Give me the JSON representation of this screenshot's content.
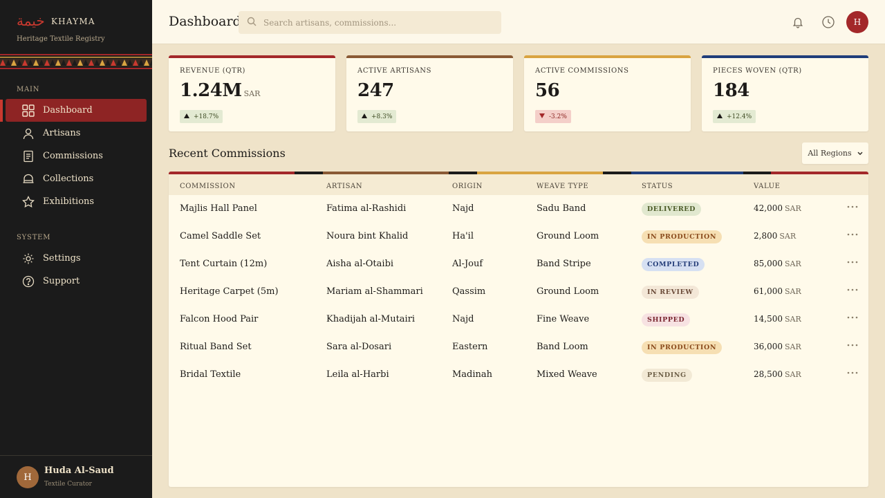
{
  "brand": {
    "logo_glyph": "خيمة",
    "name": "KHAYMA",
    "subtitle": "Heritage Textile Registry",
    "logo_color": "#c9392f"
  },
  "sidebar": {
    "main_label": "MAIN",
    "system_label": "SYSTEM",
    "main_items": [
      {
        "label": "Dashboard",
        "icon": "grid-icon",
        "active": true
      },
      {
        "label": "Artisans",
        "icon": "user-icon"
      },
      {
        "label": "Commissions",
        "icon": "document-icon"
      },
      {
        "label": "Collections",
        "icon": "tent-icon"
      },
      {
        "label": "Exhibitions",
        "icon": "star-icon"
      }
    ],
    "system_items": [
      {
        "label": "Settings",
        "icon": "gear-icon"
      },
      {
        "label": "Support",
        "icon": "help-icon"
      }
    ],
    "user": {
      "initial": "H",
      "name": "Huda Al-Saud",
      "role": "Textile Curator"
    }
  },
  "header": {
    "title": "Dashboard",
    "search_placeholder": "Search artisans, commissions...",
    "avatar_initial": "H"
  },
  "stats": [
    {
      "label": "REVENUE (QTR)",
      "value": "1.24M",
      "unit": "SAR",
      "change": "+18.7%",
      "trend": "up",
      "color": "#a3282a"
    },
    {
      "label": "ACTIVE ARTISANS",
      "value": "247",
      "unit": "",
      "change": "+8.3%",
      "trend": "up",
      "color": "#8a5a35"
    },
    {
      "label": "ACTIVE COMMISSIONS",
      "value": "56",
      "unit": "",
      "change": "-3.2%",
      "trend": "down",
      "color": "#d9a441"
    },
    {
      "label": "PIECES WOVEN (QTR)",
      "value": "184",
      "unit": "",
      "change": "+12.4%",
      "trend": "up",
      "color": "#1f3d7a"
    }
  ],
  "commissions": {
    "title": "Recent Commissions",
    "filter": "All Regions",
    "columns": [
      "COMMISSION",
      "ARTISAN",
      "ORIGIN",
      "WEAVE TYPE",
      "STATUS",
      "VALUE"
    ],
    "rows": [
      {
        "commission": "Majlis Hall Panel",
        "artisan": "Fatima al-Rashidi",
        "origin": "Najd",
        "weave": "Sadu Band",
        "status": "DELIVERED",
        "value": "42,000",
        "unit": "SAR"
      },
      {
        "commission": "Camel Saddle Set",
        "artisan": "Noura bint Khalid",
        "origin": "Ha'il",
        "weave": "Ground Loom",
        "status": "IN PRODUCTION",
        "value": "2,800",
        "unit": "SAR"
      },
      {
        "commission": "Tent Curtain (12m)",
        "artisan": "Aisha al-Otaibi",
        "origin": "Al-Jouf",
        "weave": "Band Stripe",
        "status": "COMPLETED",
        "value": "85,000",
        "unit": "SAR"
      },
      {
        "commission": "Heritage Carpet (5m)",
        "artisan": "Mariam al-Shammari",
        "origin": "Qassim",
        "weave": "Ground Loom",
        "status": "IN REVIEW",
        "value": "61,000",
        "unit": "SAR"
      },
      {
        "commission": "Falcon Hood Pair",
        "artisan": "Khadijah al-Mutairi",
        "origin": "Najd",
        "weave": "Fine Weave",
        "status": "SHIPPED",
        "value": "14,500",
        "unit": "SAR"
      },
      {
        "commission": "Ritual Band Set",
        "artisan": "Sara al-Dosari",
        "origin": "Eastern",
        "weave": "Band Loom",
        "status": "IN PRODUCTION",
        "value": "36,000",
        "unit": "SAR"
      },
      {
        "commission": "Bridal Textile",
        "artisan": "Leila al-Harbi",
        "origin": "Madinah",
        "weave": "Mixed Weave",
        "status": "PENDING",
        "value": "28,500",
        "unit": "SAR"
      }
    ]
  },
  "status_colors": {
    "DELIVERED": {
      "bg": "#e1e8cf",
      "fg": "#4a5a26"
    },
    "IN PRODUCTION": {
      "bg": "#f6dfb3",
      "fg": "#8a4b1c"
    },
    "COMPLETED": {
      "bg": "#d6e0f2",
      "fg": "#243d78"
    },
    "IN REVIEW": {
      "bg": "#f3e7d7",
      "fg": "#6a4a38"
    },
    "SHIPPED": {
      "bg": "#f7e2e2",
      "fg": "#7a2630"
    },
    "PENDING": {
      "bg": "#f2e9d5",
      "fg": "#6e6048"
    }
  }
}
